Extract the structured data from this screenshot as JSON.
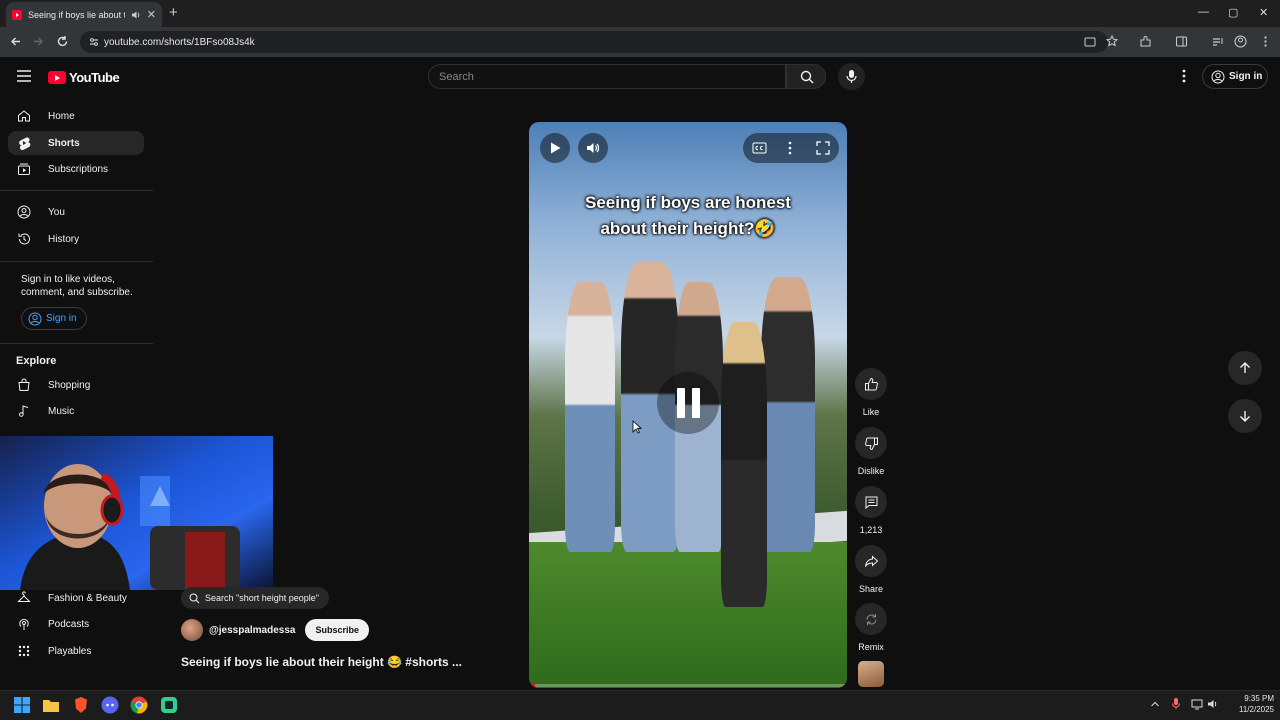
{
  "browser": {
    "tab_title": "Seeing if boys lie about the...",
    "url": "youtube.com/shorts/1BFso08Js4k",
    "new_tab": "+",
    "close_tab": "✕",
    "win_min": "—",
    "win_max": "▢",
    "win_close": "✕"
  },
  "header": {
    "logo_text": "YouTube",
    "search_placeholder": "Search",
    "sign_in": "Sign in"
  },
  "sidebar": {
    "items": [
      {
        "label": "Home",
        "icon": "home-icon"
      },
      {
        "label": "Shorts",
        "icon": "shorts-icon"
      },
      {
        "label": "Subscriptions",
        "icon": "subscriptions-icon"
      },
      {
        "label": "You",
        "icon": "you-icon"
      },
      {
        "label": "History",
        "icon": "history-icon"
      }
    ],
    "signin_note": "Sign in to like videos, comment, and subscribe.",
    "sign_in": "Sign in",
    "explore_title": "Explore",
    "explore_items": [
      {
        "label": "Shopping",
        "icon": "shopping-icon"
      },
      {
        "label": "Music",
        "icon": "music-icon"
      },
      {
        "label": "Fashion & Beauty",
        "icon": "fashion-icon"
      },
      {
        "label": "Podcasts",
        "icon": "podcasts-icon"
      },
      {
        "label": "Playables",
        "icon": "playables-icon"
      }
    ]
  },
  "video": {
    "caption_line1": "Seeing if boys are honest",
    "caption_line2": "about their height?🤣",
    "progress": 0.02
  },
  "actions": {
    "like": "Like",
    "dislike": "Dislike",
    "comments": "1,213",
    "share": "Share",
    "remix": "Remix"
  },
  "info": {
    "search_chip": "Search \"short height people\"",
    "channel": "@jesspalmadessa",
    "subscribe": "Subscribe",
    "title": "Seeing if boys lie about their height 😂 #shorts ..."
  },
  "taskbar": {
    "time": "9:35 PM",
    "date": "11/2/2025"
  },
  "colors": {
    "brand": "#ff0033",
    "background": "#0f0f0f",
    "link": "#3ea6ff"
  }
}
